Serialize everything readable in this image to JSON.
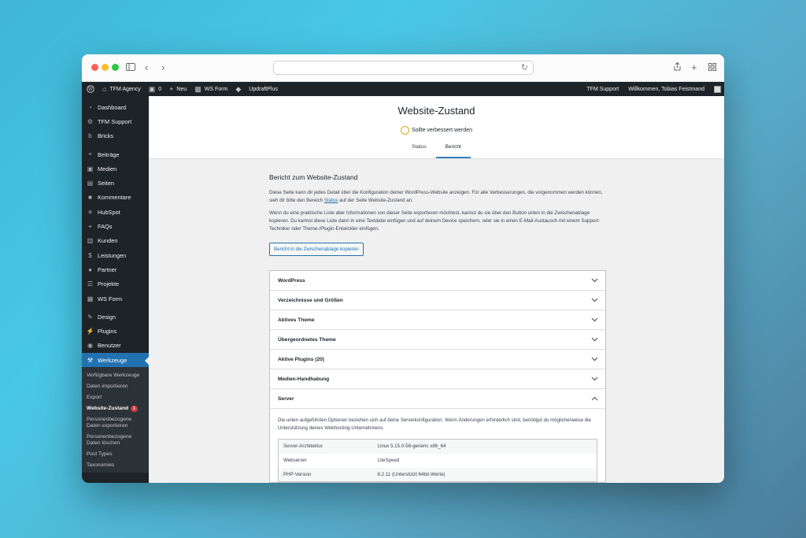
{
  "chrome": {
    "icons": [
      "sidebar-icon",
      "back-icon",
      "forward-icon",
      "reload-icon",
      "share-icon",
      "new-tab-icon",
      "tabs-grid-icon"
    ]
  },
  "adminbar": {
    "site_name": "TFM Agency",
    "comments_count": "0",
    "new_label": "Neu",
    "ws_form_label": "WS Form",
    "updraft_label": "UpdraftPlus",
    "support_label": "TFM Support",
    "greeting": "Willkommen, Tobias Feistmand"
  },
  "sidebar": {
    "items": [
      {
        "label": "Dashboard",
        "icon": "dashboard-icon"
      },
      {
        "label": "TFM Support",
        "icon": "gear-icon"
      },
      {
        "label": "Bricks",
        "icon": "bricks-icon"
      },
      {
        "label": "Beiträge",
        "icon": "pin-icon"
      },
      {
        "label": "Medien",
        "icon": "media-icon"
      },
      {
        "label": "Seiten",
        "icon": "pages-icon"
      },
      {
        "label": "Kommentare",
        "icon": "comment-icon"
      },
      {
        "label": "HubSpot",
        "icon": "hubspot-icon"
      },
      {
        "label": "FAQs",
        "icon": "pin-icon"
      },
      {
        "label": "Kunden",
        "icon": "clipboard-icon"
      },
      {
        "label": "Leistungen",
        "icon": "dollar-icon"
      },
      {
        "label": "Partner",
        "icon": "person-icon"
      },
      {
        "label": "Projekte",
        "icon": "list-icon"
      },
      {
        "label": "WS Form",
        "icon": "wsform-icon"
      },
      {
        "label": "Design",
        "icon": "brush-icon"
      },
      {
        "label": "Plugins",
        "icon": "plugin-icon"
      },
      {
        "label": "Benutzer",
        "icon": "users-icon"
      },
      {
        "label": "Werkzeuge",
        "icon": "wrench-icon"
      }
    ],
    "submenu": [
      "Verfügbare Werkzeuge",
      "Daten importieren",
      "Export",
      "Website-Zustand",
      "Personenbezogene Daten exportieren",
      "Personenbezogene Daten löschen",
      "Post Types",
      "Taxonomies"
    ],
    "submenu_badge": "1"
  },
  "health": {
    "title": "Website-Zustand",
    "status": "Sollte verbessert werden",
    "tabs": [
      "Status",
      "Bericht"
    ]
  },
  "report": {
    "heading": "Bericht zum Website-Zustand",
    "para1_a": "Diese Seite kann dir jedes Detail über die Konfiguration deiner WordPress-Website anzeigen. Für alle Verbesserungen, die vorgenommen werden können, sieh dir bitte den Bereich ",
    "para1_link": "Status",
    "para1_b": " auf der Seite Website-Zustand an.",
    "para2": "Wenn du eine praktische Liste aller Informationen von dieser Seite exportieren möchtest, kannst du sie über den Button unten in die Zwischenablage kopieren. Du kannst diese Liste dann in eine Textdatei einfügen und auf deinem Device speichern, oder sie in einen E-Mail-Austausch mit einem Support-Techniker oder Theme-/Plugin-Entwickler einfügen.",
    "copy_button": "Bericht in die Zwischenablage kopieren",
    "sections": [
      "WordPress",
      "Verzeichnisse und Größen",
      "Aktives Theme",
      "Übergeordnetes Theme",
      "Aktive Plugins (20)",
      "Medien-Handhabung",
      "Server"
    ],
    "server_intro": "Die unten aufgeführten Optionen beziehen sich auf deine Serverkonfiguration. Wenn Änderungen erforderlich sind, benötigst du möglicherweise die Unterstützung deines Webhosting-Unternehmens.",
    "server_rows": [
      {
        "key": "Server-Architektur",
        "value": "Linux 5.15.0-56-generic x86_64"
      },
      {
        "key": "Webserver",
        "value": "LiteSpeed"
      },
      {
        "key": "PHP-Version",
        "value": "8.2.11 (Unterstützt 64bit-Werte)"
      }
    ]
  }
}
